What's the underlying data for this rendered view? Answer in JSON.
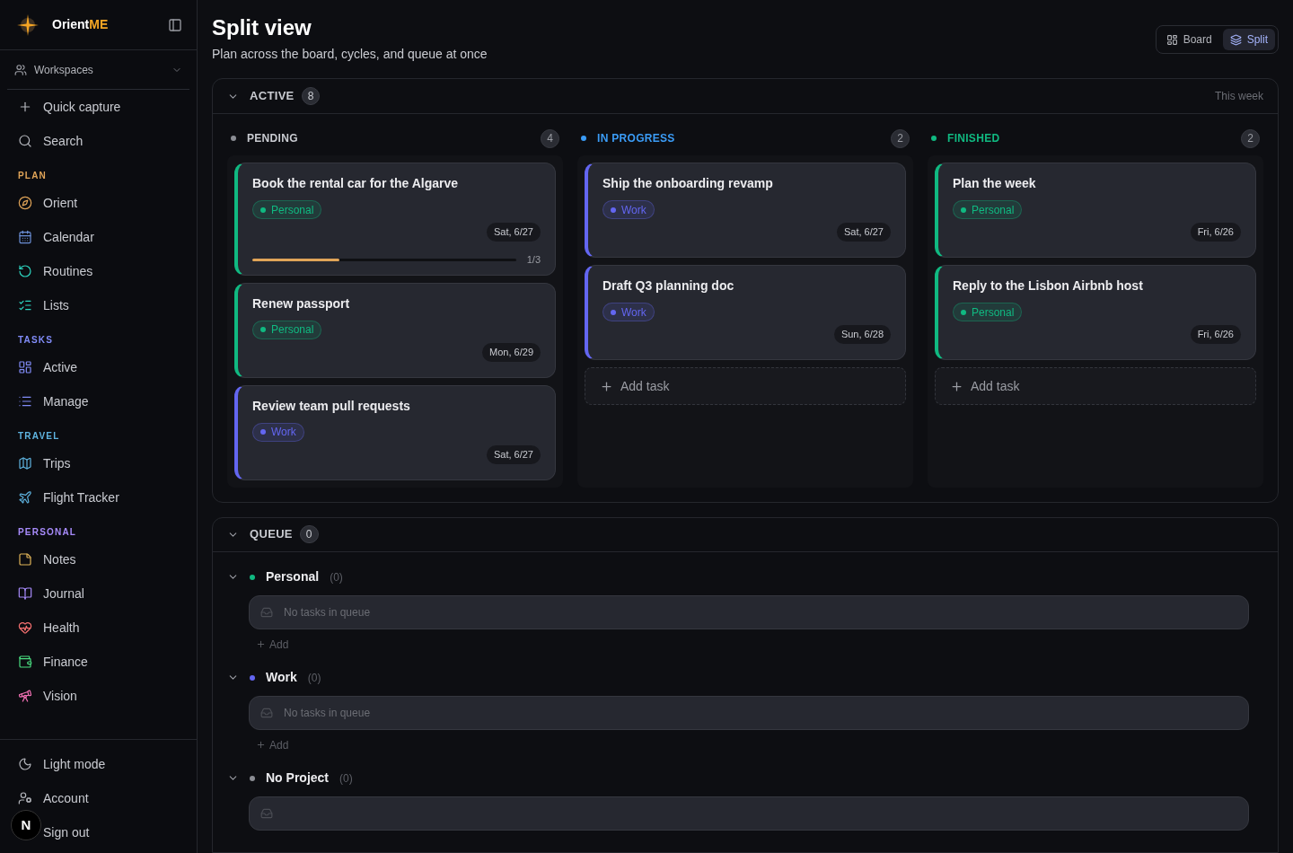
{
  "sidebar": {
    "brand": {
      "name": "Orient",
      "accent": "ME"
    },
    "workspace": "Workspaces",
    "top_items": [
      {
        "label": "Quick capture"
      },
      {
        "label": "Search"
      }
    ],
    "sections": [
      {
        "title": "PLAN",
        "color": "#e0a458",
        "items": [
          {
            "label": "Orient"
          },
          {
            "label": "Calendar"
          },
          {
            "label": "Routines"
          },
          {
            "label": "Lists"
          }
        ]
      },
      {
        "title": "TASKS",
        "color": "#818cf8",
        "items": [
          {
            "label": "Active"
          },
          {
            "label": "Manage"
          }
        ]
      },
      {
        "title": "TRAVEL",
        "color": "#5fb4e0",
        "items": [
          {
            "label": "Trips"
          },
          {
            "label": "Flight Tracker"
          }
        ]
      },
      {
        "title": "PERSONAL",
        "color": "#a78bfa",
        "items": [
          {
            "label": "Notes"
          },
          {
            "label": "Journal"
          },
          {
            "label": "Health"
          },
          {
            "label": "Finance"
          },
          {
            "label": "Vision"
          }
        ]
      }
    ],
    "footer_items": [
      {
        "label": "Light mode"
      },
      {
        "label": "Account"
      },
      {
        "label": "Sign out"
      }
    ],
    "dev_badge": "N"
  },
  "header": {
    "title": "Split view",
    "subtitle": "Plan across the board, cycles, and queue at once",
    "views": [
      {
        "label": "Board",
        "selected": false
      },
      {
        "label": "Split",
        "selected": true
      }
    ]
  },
  "active": {
    "title": "ACTIVE",
    "count": "8",
    "expanded": true,
    "range": "This week",
    "columns": [
      {
        "title": "PENDING",
        "count": "4",
        "color": "#8b8d94",
        "cards": [
          {
            "title": "Book the rental car for the Algarve",
            "tag": {
              "label": "Personal",
              "color": "#10b981"
            },
            "date": "Sat, 6/27",
            "progress": {
              "level": 0.33,
              "reading": "1/3"
            }
          },
          {
            "title": "Renew passport",
            "tag": {
              "label": "Personal",
              "color": "#10b981"
            },
            "date": "Mon, 6/29"
          },
          {
            "title": "Review team pull requests",
            "tag": {
              "label": "Work",
              "color": "#6366f1"
            },
            "date": "Sat, 6/27"
          }
        ]
      },
      {
        "title": "IN PROGRESS",
        "count": "2",
        "color": "#3b9cf6",
        "cards": [
          {
            "title": "Ship the onboarding revamp",
            "tag": {
              "label": "Work",
              "color": "#6366f1"
            },
            "date": "Sat, 6/27"
          },
          {
            "title": "Draft Q3 planning doc",
            "tag": {
              "label": "Work",
              "color": "#6366f1"
            },
            "date": "Sun, 6/28"
          }
        ],
        "add_label": "Add task"
      },
      {
        "title": "FINISHED",
        "count": "2",
        "color": "#10b981",
        "cards": [
          {
            "title": "Plan the week",
            "tag": {
              "label": "Personal",
              "color": "#10b981"
            },
            "date": "Fri, 6/26"
          },
          {
            "title": "Reply to the Lisbon Airbnb host",
            "tag": {
              "label": "Personal",
              "color": "#10b981"
            },
            "date": "Fri, 6/26"
          }
        ],
        "add_label": "Add task"
      }
    ]
  },
  "queue": {
    "title": "QUEUE",
    "count": "0",
    "expanded": true,
    "groups": [
      {
        "name": "Personal",
        "color": "#10b981",
        "count": "(0)",
        "expanded": true,
        "empty_text": "No tasks in queue",
        "add_label": "Add"
      },
      {
        "name": "Work",
        "color": "#6366f1",
        "count": "(0)",
        "expanded": true,
        "empty_text": "No tasks in queue",
        "add_label": "Add"
      },
      {
        "name": "No Project",
        "color": "#8b8d94",
        "count": "(0)",
        "expanded": true
      }
    ]
  }
}
